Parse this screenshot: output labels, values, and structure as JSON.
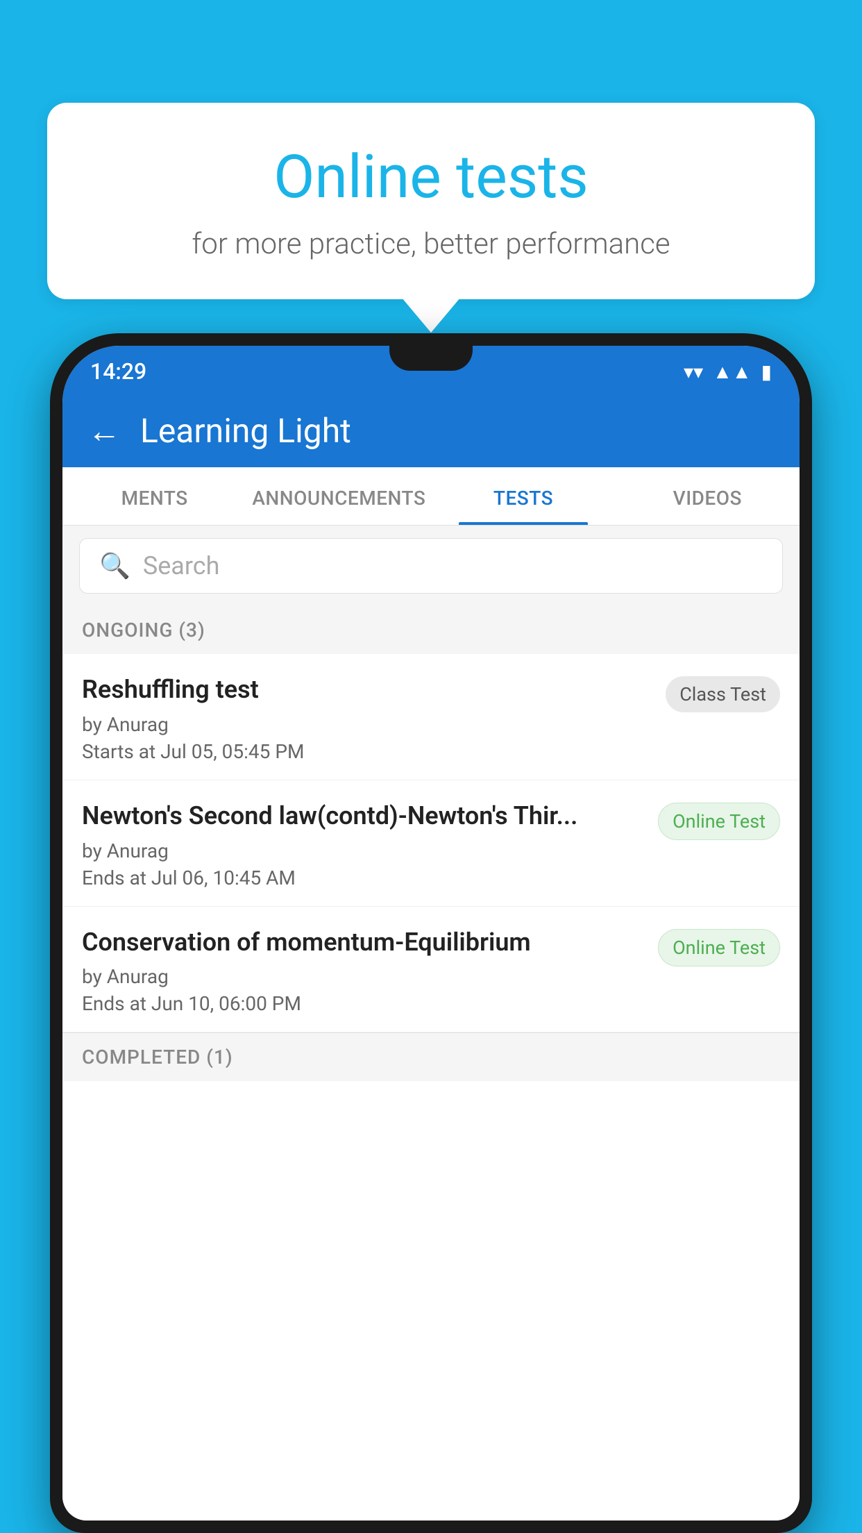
{
  "background_color": "#1ab4e8",
  "bubble": {
    "title": "Online tests",
    "subtitle": "for more practice, better performance"
  },
  "status_bar": {
    "time": "14:29",
    "wifi": "▼",
    "signal": "▲",
    "battery": "▮"
  },
  "app_bar": {
    "back_label": "←",
    "title": "Learning Light"
  },
  "tabs": [
    {
      "label": "MENTS",
      "active": false
    },
    {
      "label": "ANNOUNCEMENTS",
      "active": false
    },
    {
      "label": "TESTS",
      "active": true
    },
    {
      "label": "VIDEOS",
      "active": false
    }
  ],
  "search": {
    "placeholder": "Search"
  },
  "ongoing_section": {
    "header": "ONGOING (3)",
    "items": [
      {
        "name": "Reshuffling test",
        "by": "by Anurag",
        "date": "Starts at  Jul 05, 05:45 PM",
        "badge": "Class Test",
        "badge_type": "class"
      },
      {
        "name": "Newton's Second law(contd)-Newton's Thir...",
        "by": "by Anurag",
        "date": "Ends at  Jul 06, 10:45 AM",
        "badge": "Online Test",
        "badge_type": "online"
      },
      {
        "name": "Conservation of momentum-Equilibrium",
        "by": "by Anurag",
        "date": "Ends at  Jun 10, 06:00 PM",
        "badge": "Online Test",
        "badge_type": "online"
      }
    ]
  },
  "completed_section": {
    "header": "COMPLETED (1)"
  }
}
